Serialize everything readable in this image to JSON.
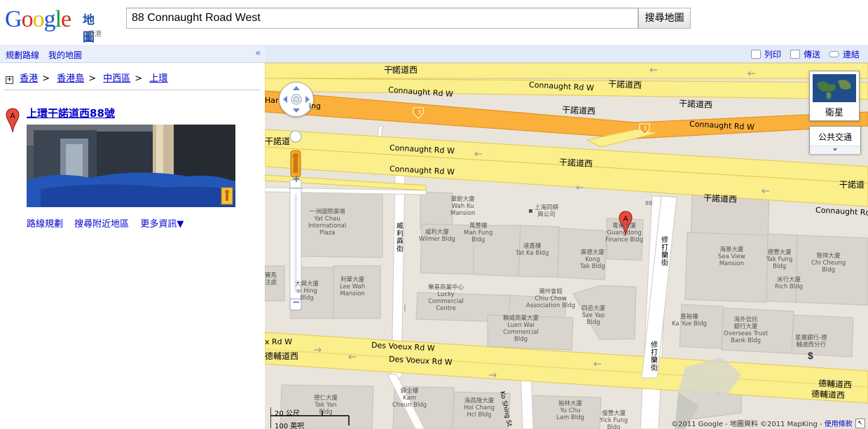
{
  "header": {
    "logo_letters": [
      "G",
      "o",
      "o",
      "g",
      "l",
      "e"
    ],
    "logo_colors": [
      "#1a57d8",
      "#d52b1e",
      "#f2b400",
      "#1a57d8",
      "#0f9d30",
      "#d52b1e"
    ],
    "product": "地圖",
    "region": "香港",
    "search_value": "88 Connaught Road West",
    "search_button": "搜尋地圖"
  },
  "toolbar": {
    "directions": "規劃路線",
    "my_maps": "我的地圖",
    "collapse": "«",
    "print": "列印",
    "send": "傳送",
    "link": "連結"
  },
  "breadcrumb": [
    "香港",
    "香港島",
    "中西區",
    "上環"
  ],
  "breadcrumb_expand": "+",
  "result": {
    "marker": "A",
    "title": "上環干諾道西88號",
    "links": [
      "路線規劃",
      "搜尋附近地區",
      "更多資訊▼"
    ]
  },
  "map_controls": {
    "zoom_in": "+",
    "zoom_out": "−",
    "satellite": "衛星",
    "transit": "公共交通"
  },
  "map_labels": {
    "connaught_zh": "干諾道西",
    "connaught_en": "Connaught Rd W",
    "desvoeux_en": "Des Voeux Rd W",
    "desvoeux_zh": "德輔道西",
    "desvoeux_en_short": "x Rd W",
    "desvoeux_zh_short": "德輔道西",
    "hwy_en_partial": "Har",
    "hwy_en_partial2": "ing",
    "connaught_zh_partial": "干諾道西",
    "connaught_zh_edge": "干諾道",
    "route_num": "3",
    "wai_lee_st": "威利蔴街",
    "sutherland_st": "修打蘭街",
    "sutherland_st2": "修打蘭街",
    "ko_shing_st": "Ko Shing St",
    "street_no": "88",
    "marker": "A"
  },
  "buildings": [
    {
      "zh": "一洲國際廣場",
      "en": "Yat Chau\nInternational\nPlaza"
    },
    {
      "zh": "華鉅大廈",
      "en": "Wah Ku\nMansion"
    },
    {
      "zh": "上海同順\n興公司",
      "en": ""
    },
    {
      "zh": "威利大廈",
      "en": "Wilmer Bldg"
    },
    {
      "zh": "萬豐樓",
      "en": "Man Fung\nBldg"
    },
    {
      "zh": "達嘉樓",
      "en": "Tat Ka Bldg"
    },
    {
      "zh": "廣德大廈",
      "en": "Kong\nTak Bldg"
    },
    {
      "zh": "粵東大廈",
      "en": "Guangdong\nFinance Bldg"
    },
    {
      "zh": "利華大廈",
      "en": "Lee Wah\nMansion"
    },
    {
      "zh": "大興大廈",
      "en": "ai Hing\nBldg"
    },
    {
      "zh": "賽馬\n注處",
      "en": ""
    },
    {
      "zh": "樂基商業中心",
      "en": "Lucky\nCommercial\nCentre"
    },
    {
      "zh": "潮州會館",
      "en": "Chiu Chow\nAssociation Bldg"
    },
    {
      "zh": "聯威商業大廈",
      "en": "Luen Wai\nCommercial\nBldg"
    },
    {
      "zh": "四邑大廈",
      "en": "Sze Yap\nBldg"
    },
    {
      "zh": "海景大廈",
      "en": "Sea View\nMansion"
    },
    {
      "zh": "德豐大廈",
      "en": "Tak Fung\nBldg"
    },
    {
      "zh": "致祥大廈",
      "en": "Chi Cheung\nBldg"
    },
    {
      "zh": "米行大廈",
      "en": "Rich Bldg"
    },
    {
      "zh": "嘉裕樓",
      "en": "Ka Yue Bldg"
    },
    {
      "zh": "海外信託\n銀行大廈",
      "en": "Overseas Trust\nBank Bldg"
    },
    {
      "zh": "星展銀行-德\n輔道西分行",
      "en": ""
    },
    {
      "zh": "德仁大廈",
      "en": "Tak Yan\nBldg"
    },
    {
      "zh": "錦全樓",
      "en": "Kam\nCheun Bldg"
    },
    {
      "zh": "海昌隆大廈",
      "en": "Hoi Chang\nHcl Bldg"
    },
    {
      "zh": "裕林大廈",
      "en": "Yu Chu\nLam Bldg"
    },
    {
      "zh": "億豐大廈",
      "en": "Yick Fung\nBldg"
    }
  ],
  "scale": {
    "metric": "20 公尺",
    "imperial": "100 英呎"
  },
  "copyright": "©2011 Google - 地圖資料 ©2011 MapKing -",
  "terms": "使用條款"
}
